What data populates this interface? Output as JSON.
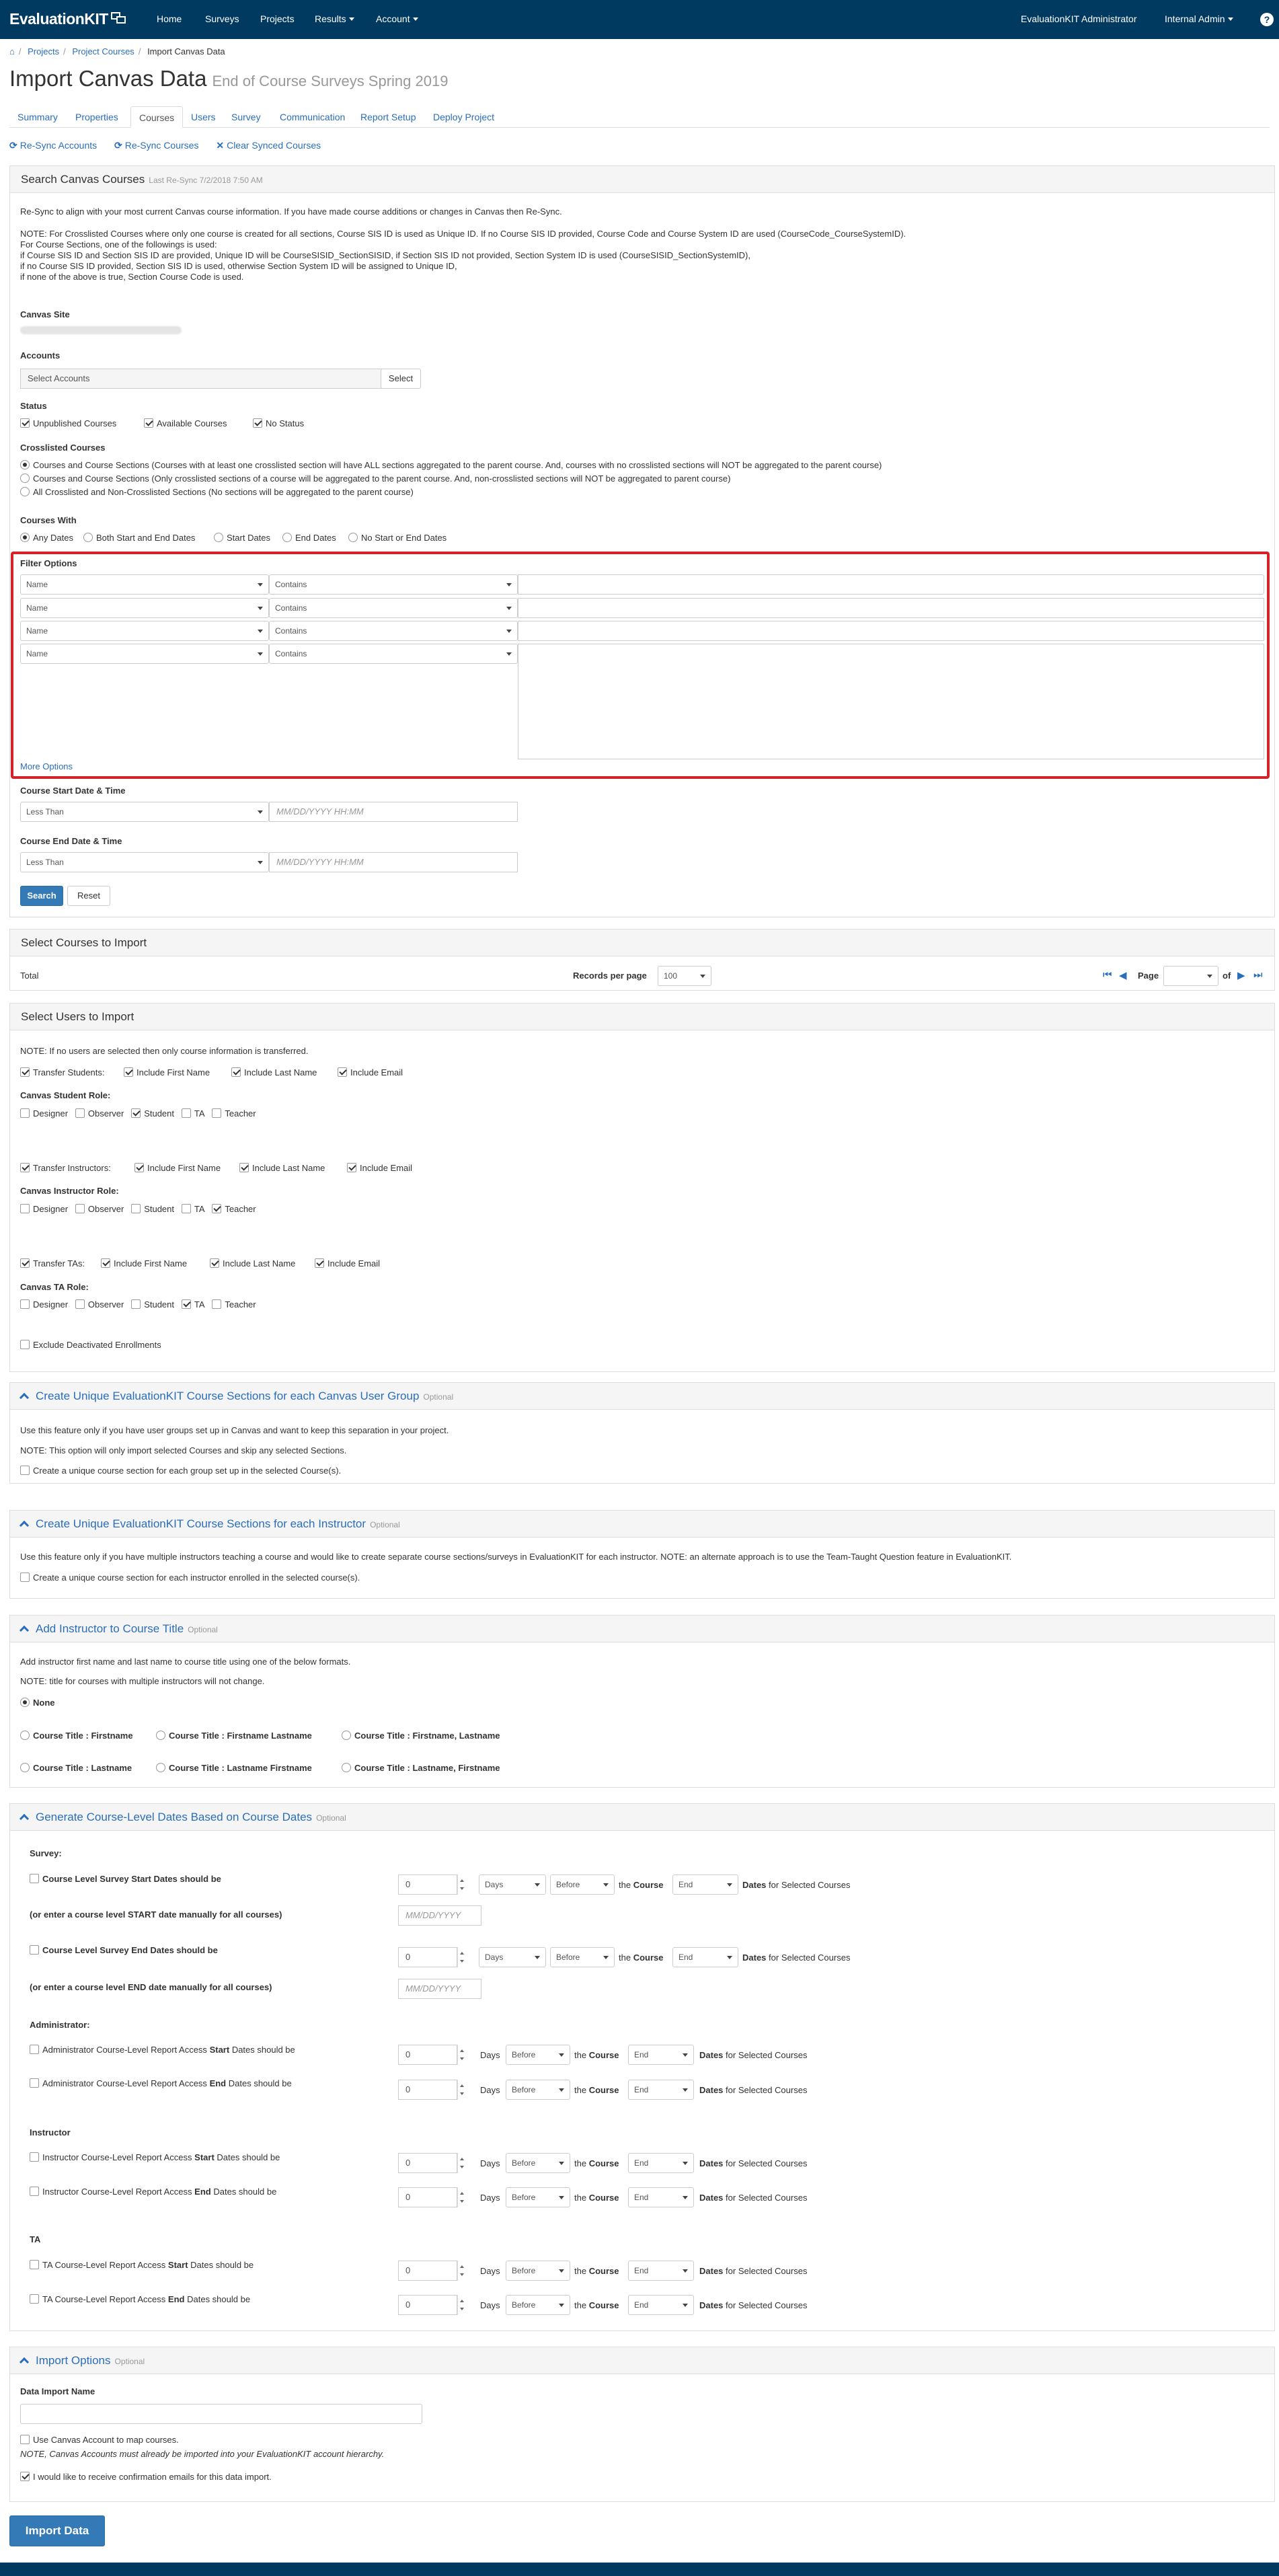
{
  "nav": {
    "brand": "EvaluationKIT",
    "home": "Home",
    "surveys": "Surveys",
    "projects": "Projects",
    "results": "Results",
    "account": "Account",
    "user": "EvaluationKIT Administrator",
    "role": "Internal Admin",
    "help": "?"
  },
  "breadcrumb": {
    "projects": "Projects",
    "project_courses": "Project Courses",
    "current": "Import Canvas Data"
  },
  "page": {
    "title": "Import Canvas Data",
    "subtitle": "End of Course Surveys Spring 2019"
  },
  "tabs": [
    "Summary",
    "Properties",
    "Courses",
    "Users",
    "Survey",
    "Communication",
    "Report Setup",
    "Deploy Project"
  ],
  "actions": {
    "resync_accounts": "Re-Sync Accounts",
    "resync_courses": "Re-Sync Courses",
    "clear_synced": "Clear Synced Courses"
  },
  "search": {
    "title": "Search Canvas Courses",
    "last_sync": "Last Re-Sync 7/2/2018 7:50 AM",
    "intro": "Re-Sync to align with your most current Canvas course information. If you have made course additions or changes in Canvas then Re-Sync.",
    "note1": "NOTE: For Crosslisted Courses where only one course is created for all sections, Course SIS ID is used as Unique ID. If no Course SIS ID provided, Course Code and Course System ID are used (CourseCode_CourseSystemID).",
    "note2": "For Course Sections, one of the followings is used:",
    "note3": "if Course SIS ID and Section SIS ID are provided, Unique ID will be CourseSISID_SectionSISID, if Section SIS ID not provided, Section System ID is used (CourseSISID_SectionSystemID),",
    "note4": "if no Course SIS ID provided, Section SIS ID is used, otherwise Section System ID will be assigned to Unique ID,",
    "note5": "if none of the above is true, Section Course Code is used.",
    "canvas_site_label": "Canvas Site",
    "accounts_label": "Accounts",
    "accounts_placeholder": "Select Accounts",
    "select_btn": "Select",
    "status_label": "Status",
    "status": [
      "Unpublished Courses",
      "Available Courses",
      "No Status"
    ],
    "crosslisted_label": "Crosslisted Courses",
    "crosslisted": [
      "Courses and Course Sections (Courses with at least one crosslisted section will have ALL sections aggregated to the parent course. And, courses with no crosslisted sections will NOT be aggregated to the parent course)",
      "Courses and Course Sections (Only crosslisted sections of a course will be aggregated to the parent course. And, non-crosslisted sections will NOT be aggregated to parent course)",
      "All Crosslisted and Non-Crosslisted Sections (No sections will be aggregated to the parent course)"
    ],
    "courses_with_label": "Courses With",
    "courses_with": [
      "Any Dates",
      "Both Start and End Dates",
      "Start Dates",
      "End Dates",
      "No Start or End Dates"
    ],
    "filter_label": "Filter Options",
    "filter_field": "Name",
    "filter_op": "Contains",
    "more_options": "More Options",
    "start_label": "Course Start Date & Time",
    "end_label": "Course End Date & Time",
    "less_than": "Less Than",
    "datetime_placeholder": "MM/DD/YYYY HH:MM",
    "search_btn": "Search",
    "reset_btn": "Reset"
  },
  "select_courses": {
    "title": "Select Courses to Import",
    "total": "Total",
    "records_label": "Records per page",
    "records_value": "100",
    "page_label": "Page",
    "of_label": "of"
  },
  "users": {
    "title": "Select Users to Import",
    "note": "NOTE: If no users are selected then only course information is transferred.",
    "transfer_students": "Transfer Students:",
    "transfer_instructors": "Transfer Instructors:",
    "transfer_tas": "Transfer TAs:",
    "first": "Include First Name",
    "last": "Include Last Name",
    "email": "Include Email",
    "student_role": "Canvas Student Role:",
    "instructor_role": "Canvas Instructor Role:",
    "ta_role": "Canvas TA Role:",
    "roles": [
      "Designer",
      "Observer",
      "Student",
      "TA",
      "Teacher"
    ],
    "exclude": "Exclude Deactivated Enrollments"
  },
  "group_sections": {
    "title": "Create Unique EvaluationKIT Course Sections for each Canvas User Group",
    "optional": "Optional",
    "desc": "Use this feature only if you have user groups set up in Canvas and want to keep this separation in your project.",
    "note": "NOTE: This option will only import selected Courses and skip any selected Sections.",
    "check": "Create a unique course section for each group set up in the selected Course(s)."
  },
  "instructor_sections": {
    "title": "Create Unique EvaluationKIT Course Sections for each Instructor",
    "optional": "Optional",
    "desc": "Use this feature only if you have multiple instructors teaching a course and would like to create separate course sections/surveys in EvaluationKIT for each instructor. NOTE: an alternate approach is to use the Team-Taught Question feature in EvaluationKIT.",
    "check": "Create a unique course section for each instructor enrolled in the selected course(s)."
  },
  "instructor_title": {
    "title": "Add Instructor to Course Title",
    "optional": "Optional",
    "desc": "Add instructor first name and last name to course title using one of the below formats.",
    "note": "NOTE: title for courses with multiple instructors will not change.",
    "none": "None",
    "formats": [
      "Course Title : Firstname",
      "Course Title : Firstname Lastname",
      "Course Title : Firstname, Lastname",
      "Course Title : Lastname",
      "Course Title : Lastname Firstname",
      "Course Title : Lastname, Firstname"
    ]
  },
  "dates": {
    "title": "Generate Course-Level Dates Based on Course Dates",
    "optional": "Optional",
    "survey_label": "Survey:",
    "survey_start": "Course Level Survey Start Dates should be",
    "survey_start_manual": "(or enter a course level START date manually for all courses)",
    "survey_end": "Course Level Survey End Dates should be",
    "survey_end_manual": "(or enter a course level END date manually for all courses)",
    "admin_label": "Administrator:",
    "admin_start_a": "Administrator Course-Level Report Access",
    "admin_end_a": "Administrator Course-Level Report Access",
    "instr_label": "Instructor",
    "instr_a": "Instructor Course-Level Report Access",
    "ta_label": "TA",
    "ta_a": "TA Course-Level Report Access",
    "start_word": "Start",
    "end_word": "End",
    "dates_should_be": "Dates should be",
    "zero": "0",
    "days": "Days",
    "before": "Before",
    "the": "the",
    "course": "Course",
    "end_sel": "End",
    "dates_word": "Dates",
    "for_selected": "for Selected Courses",
    "date_placeholder": "MM/DD/YYYY"
  },
  "import_opts": {
    "title": "Import Options",
    "optional": "Optional",
    "name_label": "Data Import Name",
    "use_account": "Use Canvas Account to map courses.",
    "note": "NOTE, Canvas Accounts must already be imported into your EvaluationKIT account hierarchy.",
    "confirm": "I would like to receive confirmation emails for this data import."
  },
  "import_btn": "Import Data"
}
